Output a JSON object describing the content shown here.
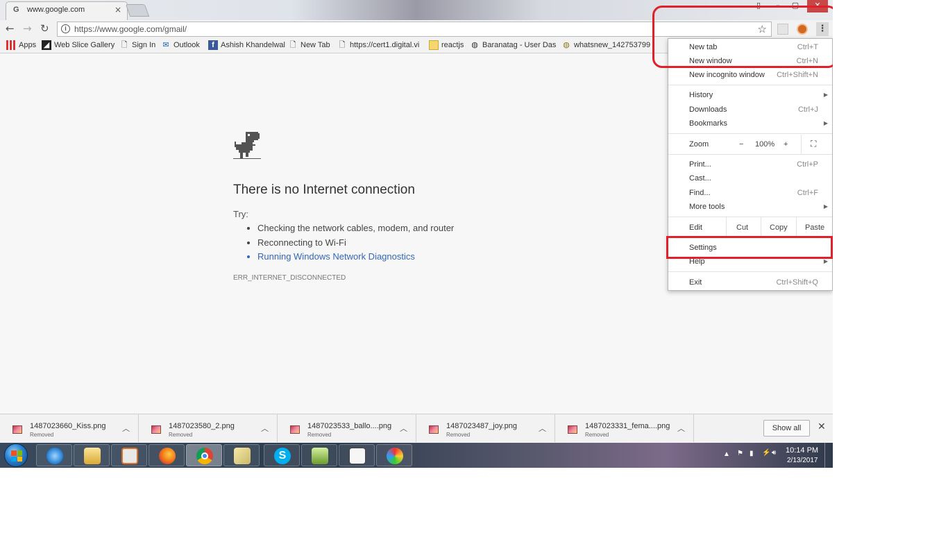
{
  "browser": {
    "tab_title": "www.google.com",
    "tab_favicon": "G",
    "url": "https://www.google.com/gmail/"
  },
  "bookmarks": [
    {
      "label": "Apps",
      "icon": "apps-grid-icon"
    },
    {
      "label": "Web Slice Gallery",
      "icon": "web-slice-icon"
    },
    {
      "label": "Sign In",
      "icon": "page-icon"
    },
    {
      "label": "Outlook",
      "icon": "mail-icon"
    },
    {
      "label": "Ashish Khandelwal",
      "icon": "facebook-icon"
    },
    {
      "label": "New Tab",
      "icon": "page-icon"
    },
    {
      "label": "https://cert1.digital.vi",
      "icon": "page-icon"
    },
    {
      "label": "reactjs",
      "icon": "folder-icon"
    },
    {
      "label": "Baranatag - User Das",
      "icon": "globe-icon"
    },
    {
      "label": "whatsnew_142753799",
      "icon": "globe-icon"
    }
  ],
  "error_page": {
    "title": "There is no Internet connection",
    "try_label": "Try:",
    "suggestions": [
      "Checking the network cables, modem, and router",
      "Reconnecting to Wi-Fi",
      "Running Windows Network Diagnostics"
    ],
    "error_code": "ERR_INTERNET_DISCONNECTED"
  },
  "menu": {
    "new_tab": {
      "label": "New tab",
      "shortcut": "Ctrl+T"
    },
    "new_window": {
      "label": "New window",
      "shortcut": "Ctrl+N"
    },
    "new_incognito": {
      "label": "New incognito window",
      "shortcut": "Ctrl+Shift+N"
    },
    "history": {
      "label": "History"
    },
    "downloads": {
      "label": "Downloads",
      "shortcut": "Ctrl+J"
    },
    "bookmarks": {
      "label": "Bookmarks"
    },
    "zoom": {
      "label": "Zoom",
      "minus": "−",
      "value": "100%",
      "plus": "+"
    },
    "print": {
      "label": "Print...",
      "shortcut": "Ctrl+P"
    },
    "cast": {
      "label": "Cast..."
    },
    "find": {
      "label": "Find...",
      "shortcut": "Ctrl+F"
    },
    "more_tools": {
      "label": "More tools"
    },
    "edit": {
      "label": "Edit",
      "cut": "Cut",
      "copy": "Copy",
      "paste": "Paste"
    },
    "settings": {
      "label": "Settings"
    },
    "help": {
      "label": "Help"
    },
    "exit": {
      "label": "Exit",
      "shortcut": "Ctrl+Shift+Q"
    }
  },
  "downloads": {
    "items": [
      {
        "name": "1487023660_Kiss.png",
        "status": "Removed"
      },
      {
        "name": "1487023580_2.png",
        "status": "Removed"
      },
      {
        "name": "1487023533_ballo....png",
        "status": "Removed"
      },
      {
        "name": "1487023487_joy.png",
        "status": "Removed"
      },
      {
        "name": "1487023331_fema....png",
        "status": "Removed"
      }
    ],
    "show_all": "Show all"
  },
  "taskbar": {
    "time": "10:14 PM",
    "date": "2/13/2017",
    "apps": [
      "internet-explorer-icon",
      "file-explorer-icon",
      "media-player-icon",
      "firefox-icon",
      "chrome-icon",
      "folder-icon",
      "skype-icon",
      "notepad-icon",
      "document-icon",
      "paint-icon"
    ]
  },
  "colors": {
    "highlight_red": "#e2202b",
    "link_blue": "#3366bb"
  }
}
